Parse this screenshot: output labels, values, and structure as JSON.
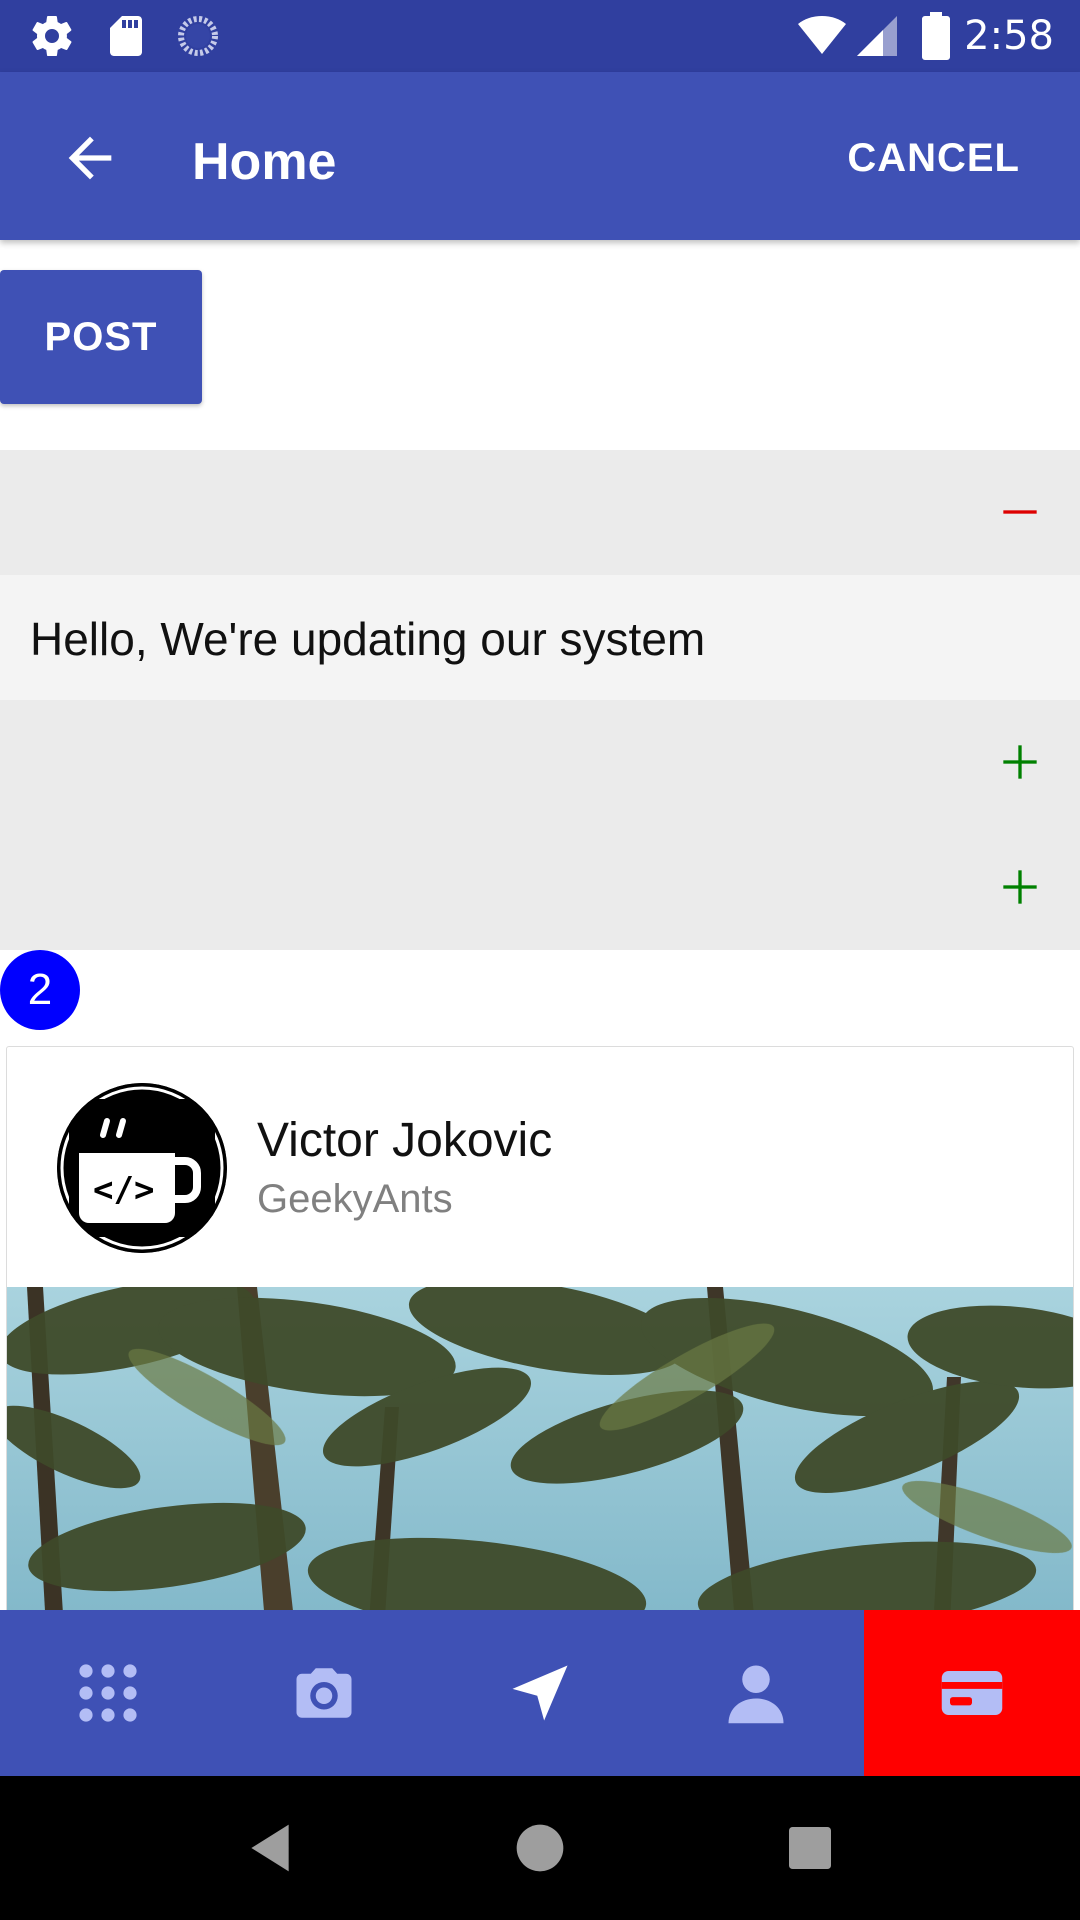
{
  "status_bar": {
    "time": "2:58",
    "left_icons": [
      "gear-icon",
      "sd-card-icon",
      "sync-spinner-icon"
    ],
    "right_icons": [
      "wifi-icon",
      "signal-icon",
      "battery-icon"
    ]
  },
  "app_bar": {
    "title": "Home",
    "cancel_label": "CANCEL",
    "back_icon": "arrow-left-icon"
  },
  "post_button": {
    "label": "POST"
  },
  "accordion": {
    "items": [
      {
        "icon": "minus-icon",
        "expanded": true,
        "content": "Hello, We're updating our system"
      },
      {
        "icon": "plus-icon",
        "expanded": false
      },
      {
        "icon": "plus-icon",
        "expanded": false
      }
    ],
    "colors": {
      "minus": "#dd0000",
      "plus": "#008000"
    }
  },
  "badge": {
    "count": "2",
    "color": "#0000ff"
  },
  "card": {
    "name": "Victor Jokovic",
    "subtitle": "GeekyAnts",
    "avatar_icon": "coffee-code-icon"
  },
  "footer": {
    "tabs": [
      {
        "icon": "apps-grid-icon",
        "active": false
      },
      {
        "icon": "camera-icon",
        "active": false
      },
      {
        "icon": "navigate-icon",
        "active": false
      },
      {
        "icon": "person-icon",
        "active": false
      },
      {
        "icon": "card-icon",
        "active": true
      }
    ],
    "colors": {
      "background": "#3f51b5",
      "active": "#ff0000",
      "icon": "#b3bdf5"
    }
  },
  "nav_bar": {
    "buttons": [
      "back-triangle-icon",
      "home-circle-icon",
      "recents-square-icon"
    ]
  },
  "colors": {
    "status_bar": "#303f9f",
    "primary": "#3f51b5"
  }
}
